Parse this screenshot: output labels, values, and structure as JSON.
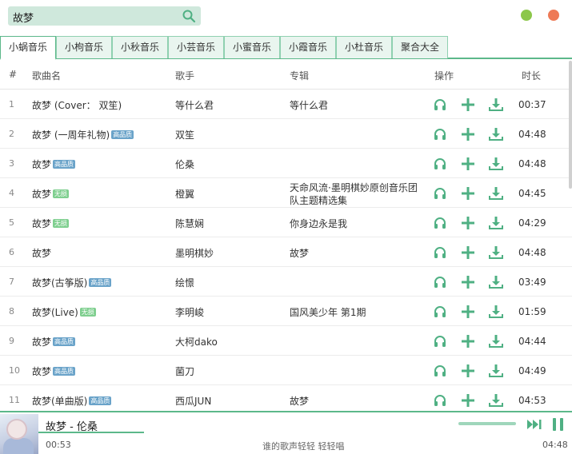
{
  "search": {
    "value": "故梦"
  },
  "colors": {
    "accent": "#5cb88a",
    "icon": "#4fb083",
    "hq_badge": "#6aa3c9",
    "lossless_badge": "#7fcf8f"
  },
  "icons": {
    "search": "search-icon",
    "listen": "headphones-icon",
    "add": "plus-icon",
    "download": "download-icon"
  },
  "tabs": [
    {
      "label": "小蜗音乐",
      "active": true
    },
    {
      "label": "小枸音乐",
      "active": false
    },
    {
      "label": "小秋音乐",
      "active": false
    },
    {
      "label": "小芸音乐",
      "active": false
    },
    {
      "label": "小蜜音乐",
      "active": false
    },
    {
      "label": "小霞音乐",
      "active": false
    },
    {
      "label": "小杜音乐",
      "active": false
    },
    {
      "label": "聚合大全",
      "active": false
    }
  ],
  "columns": {
    "index": "#",
    "title": "歌曲名",
    "singer": "歌手",
    "album": "专辑",
    "ops": "操作",
    "duration": "时长"
  },
  "songs": [
    {
      "idx": "1",
      "title": "故梦 (Cover： 双笙)",
      "badge": "",
      "singer": "等什么君",
      "album": "等什么君",
      "duration": "00:37"
    },
    {
      "idx": "2",
      "title": "故梦 (一周年礼物)",
      "badge": "高品质",
      "singer": "双笙",
      "album": "",
      "duration": "04:48"
    },
    {
      "idx": "3",
      "title": "故梦",
      "badge": "高品质",
      "singer": "伦桑",
      "album": "",
      "duration": "04:48"
    },
    {
      "idx": "4",
      "title": "故梦",
      "badge": "无损",
      "singer": "橙翼",
      "album": "天命风流·墨明棋妙原创音乐团队主题精选集",
      "duration": "04:45"
    },
    {
      "idx": "5",
      "title": "故梦",
      "badge": "无损",
      "singer": "陈慧娴",
      "album": "你身边永是我",
      "duration": "04:29"
    },
    {
      "idx": "6",
      "title": "故梦",
      "badge": "",
      "singer": "墨明棋妙",
      "album": "故梦",
      "duration": "04:48"
    },
    {
      "idx": "7",
      "title": "故梦(古筝版)",
      "badge": "高品质",
      "singer": "绘憬",
      "album": "",
      "duration": "03:49"
    },
    {
      "idx": "8",
      "title": "故梦(Live)",
      "badge": "无损",
      "singer": "李明峻",
      "album": "国风美少年 第1期",
      "duration": "01:59"
    },
    {
      "idx": "9",
      "title": "故梦",
      "badge": "高品质",
      "singer": "大柯dako",
      "album": "",
      "duration": "04:44"
    },
    {
      "idx": "10",
      "title": "故梦",
      "badge": "高品质",
      "singer": "菌刀",
      "album": "",
      "duration": "04:49"
    },
    {
      "idx": "11",
      "title": "故梦(单曲版)",
      "badge": "高品质",
      "singer": "西瓜JUN",
      "album": "故梦",
      "duration": "04:53"
    }
  ],
  "player": {
    "title": "故梦 - 伦桑",
    "current_time": "00:53",
    "total_time": "04:48",
    "lyric": "谁的歌声轻轻 轻轻唱",
    "progress": 0.184
  }
}
